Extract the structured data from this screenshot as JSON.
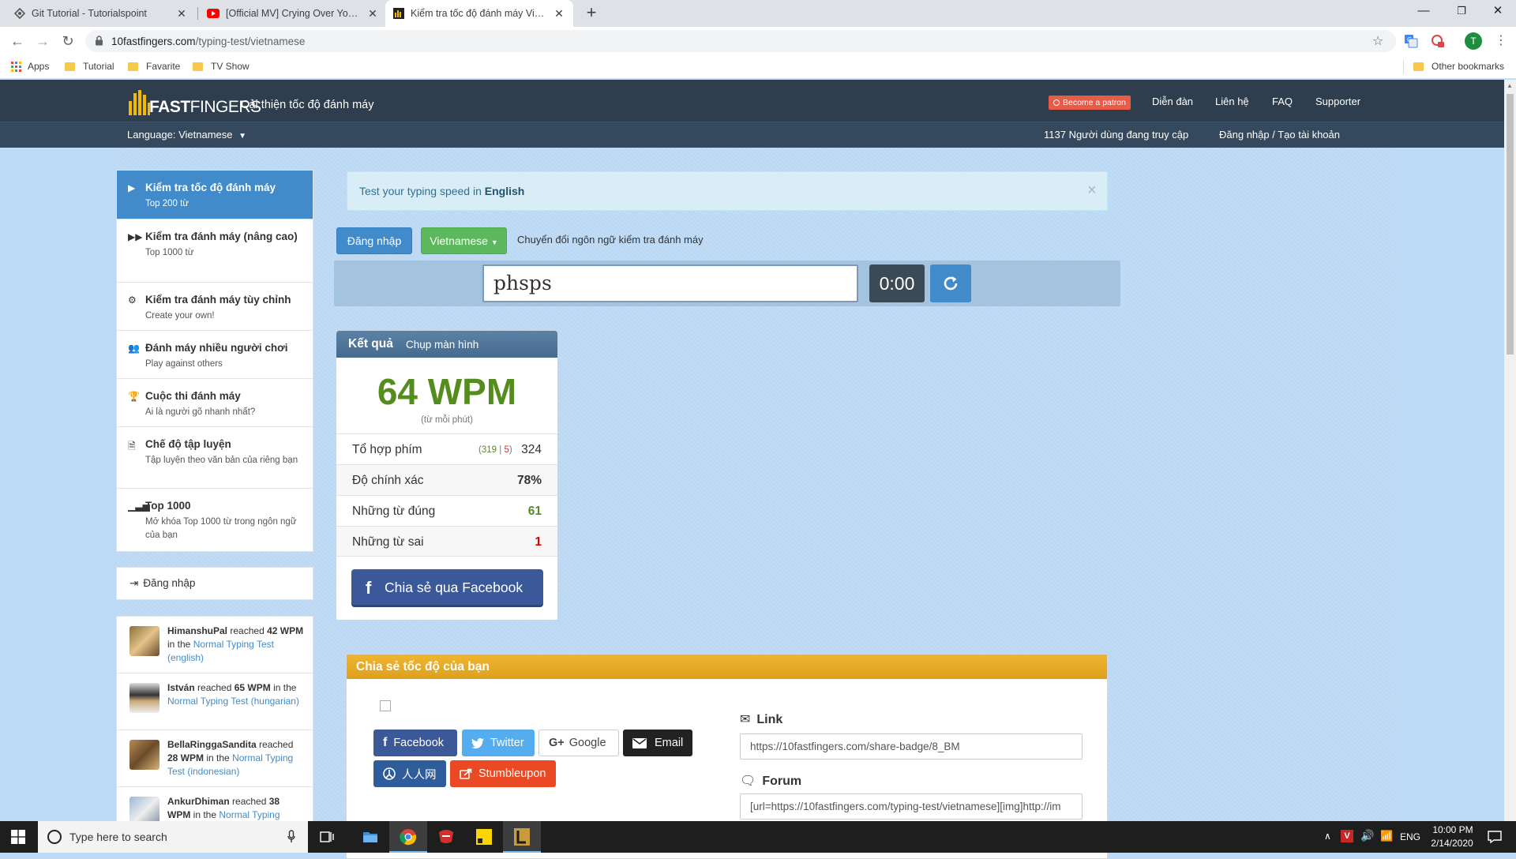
{
  "browser": {
    "tabs": [
      {
        "title": "Git Tutorial - Tutorialspoint",
        "icon": "tutorialspoint-icon"
      },
      {
        "title": "[Official MV] Crying Over You - Ju",
        "icon": "youtube-icon"
      },
      {
        "title": "Kiểm tra tốc độ đánh máy Vietna",
        "icon": "10fastfingers-icon"
      }
    ],
    "url_host": "10fastfingers.com",
    "url_path": "/typing-test/vietnamese",
    "profile_initial": "T",
    "bookmarks": [
      "Apps",
      "Tutorial",
      "Favarite",
      "TV Show"
    ],
    "other_bookmarks": "Other bookmarks"
  },
  "site": {
    "logo_prefix": "10",
    "logo_bold": "FAST",
    "logo_light": "FINGERS",
    "tagline": "Cải thiện tốc độ đánh máy",
    "patron": "Become a patron",
    "nav": [
      "Diễn đàn",
      "Liên hệ",
      "FAQ",
      "Supporter"
    ],
    "language": "Language: Vietnamese",
    "online": "1137 Người dùng đang truy cập",
    "login_register": "Đăng nhập / Tạo tài khoản"
  },
  "sidebar": {
    "items": [
      {
        "title": "Kiểm tra tốc độ đánh máy",
        "sub": "Top 200 từ",
        "icon": "play-icon"
      },
      {
        "title": "Kiểm tra đánh máy (nâng cao)",
        "sub": "Top 1000 từ",
        "icon": "fast-forward-icon"
      },
      {
        "title": "Kiểm tra đánh máy tùy chỉnh",
        "sub": "Create your own!",
        "icon": "cogs-icon"
      },
      {
        "title": "Đánh máy nhiều người chơi",
        "sub": "Play against others",
        "icon": "users-icon"
      },
      {
        "title": "Cuộc thi đánh máy",
        "sub": "Ai là người gõ nhanh nhất?",
        "icon": "trophy-icon"
      },
      {
        "title": "Chế độ tập luyện",
        "sub": "Tập luyện theo văn bản của riêng bạn",
        "icon": "document-icon"
      },
      {
        "title": "Top 1000",
        "sub": "Mở khóa Top 1000 từ trong ngôn ngữ của bạn",
        "icon": "signal-icon"
      }
    ],
    "login": "Đăng nhập",
    "feed": [
      {
        "user": "HimanshuPal",
        "reached": "reached",
        "wpm": "42 WPM",
        "in": "in the",
        "test": "Normal Typing Test (english)"
      },
      {
        "user": "István",
        "reached": "reached",
        "wpm": "65 WPM",
        "in": "in the",
        "test": "Normal Typing Test (hungarian)"
      },
      {
        "user": "BellaRinggaSandita",
        "reached": "reached",
        "wpm": "28 WPM",
        "in": "in the",
        "test": "Normal Typing Test (indonesian)"
      },
      {
        "user": "AnkurDhiman",
        "reached": "reached",
        "wpm": "38 WPM",
        "in": "in the",
        "test": "Normal Typing"
      }
    ]
  },
  "main": {
    "alert_prefix": "Test your typing speed in",
    "alert_lang": "English",
    "alert_close": "×",
    "login_btn": "Đăng nhập",
    "lang_btn": "Vietnamese",
    "switch_text": "Chuyển đổi ngôn ngữ kiểm tra đánh máy",
    "input_value": "phsps",
    "timer": "0:00",
    "results": {
      "title": "Kết quả",
      "screenshot": "Chụp màn hình",
      "wpm": "64 WPM",
      "wpm_sub": "(từ mỗi phút)",
      "keystrokes_label": "Tổ hợp phím",
      "keystrokes_correct": "319",
      "keystrokes_sep": "|",
      "keystrokes_wrong": "5",
      "keystrokes_total": "324",
      "accuracy_label": "Độ chính xác",
      "accuracy": "78%",
      "correct_label": "Những từ đúng",
      "correct": "61",
      "wrong_label": "Những từ sai",
      "wrong": "1",
      "facebook": "Chia sẻ qua Facebook"
    },
    "share": {
      "title": "Chia sẻ tốc độ của bạn",
      "buttons": [
        "Facebook",
        "Twitter",
        "Google",
        "Email",
        "人人网",
        "Stumbleupon"
      ],
      "link_label": "Link",
      "link_value": "https://10fastfingers.com/share-badge/8_BM",
      "forum_label": "Forum",
      "forum_value": "[url=https://10fastfingers.com/typing-test/vietnamese][img]http://im"
    }
  },
  "taskbar": {
    "search_placeholder": "Type here to search",
    "lang": "ENG",
    "time": "10:00 PM",
    "date": "2/14/2020"
  },
  "colors": {
    "header_dark": "#2e3e4e",
    "header_bar": "#34495e",
    "page_bg": "#bcd9f5",
    "primary": "#428bca",
    "green": "#5cb85c",
    "wpm_green": "#558c1e",
    "facebook": "#3b5998",
    "twitter": "#55acee",
    "stumble": "#eb4924",
    "share_header": "#e8aa28"
  }
}
